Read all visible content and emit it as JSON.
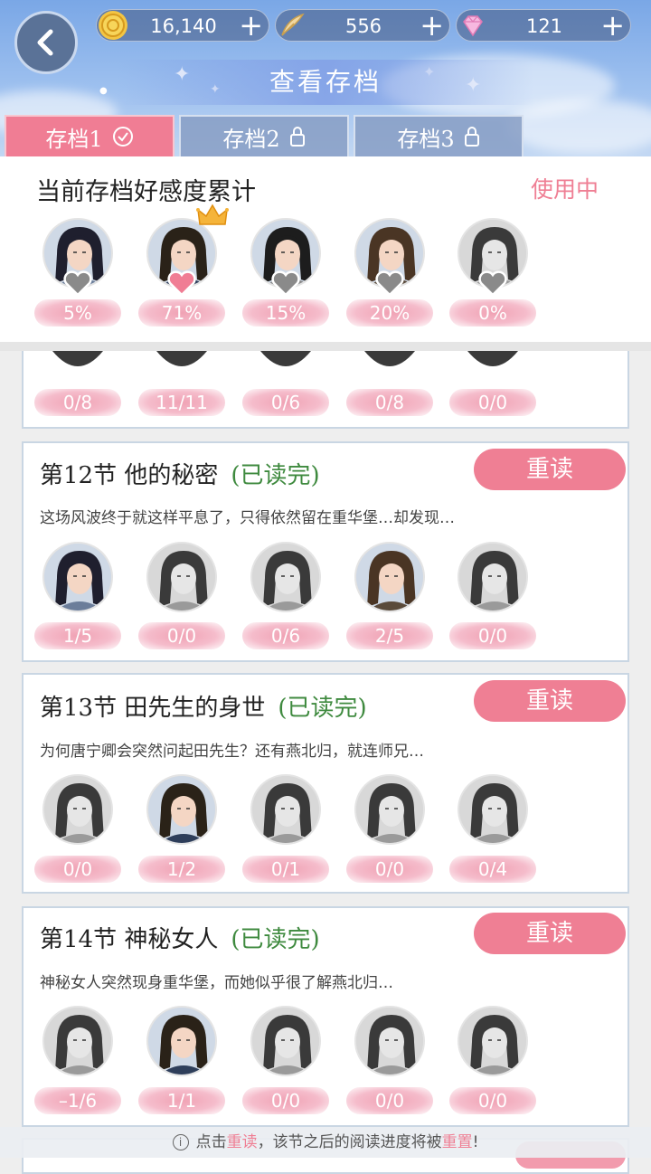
{
  "colors": {
    "accent": "#ef7f94",
    "done_green": "#3f8a3f",
    "header_blue": "#8fb3ea"
  },
  "header": {
    "back_icon": "chevron-left-icon",
    "title": "查看存档",
    "resources": [
      {
        "name": "coin",
        "icon": "coin-icon",
        "value": "16,140"
      },
      {
        "name": "quill",
        "icon": "quill-icon",
        "value": "556"
      },
      {
        "name": "diamond",
        "icon": "diamond-icon",
        "value": "121"
      }
    ],
    "tabs": [
      {
        "label": "存档1",
        "icon": "check-circle-icon",
        "active": true
      },
      {
        "label": "存档2",
        "icon": "lock-icon",
        "active": false
      },
      {
        "label": "存档3",
        "icon": "lock-icon",
        "active": false
      }
    ]
  },
  "summary": {
    "title": "当前存档好感度累计",
    "status": "使用中",
    "characters": [
      {
        "affection": "5%",
        "heart_filled": false,
        "crown": false,
        "color": true
      },
      {
        "affection": "71%",
        "heart_filled": true,
        "crown": true,
        "color": true
      },
      {
        "affection": "15%",
        "heart_filled": false,
        "crown": false,
        "color": true
      },
      {
        "affection": "20%",
        "heart_filled": false,
        "crown": false,
        "color": true
      },
      {
        "affection": "0%",
        "heart_filled": false,
        "crown": false,
        "color": false
      }
    ]
  },
  "partial_chapter": {
    "values": [
      "0/8",
      "11/11",
      "0/6",
      "0/8",
      "0/0"
    ]
  },
  "chapters": [
    {
      "title": "第12节 他的秘密",
      "status": "(已读完)",
      "description": "这场风波终于就这样平息了，只得依然留在重华堡…却发现…",
      "reread_label": "重读",
      "values": [
        "1/5",
        "0/0",
        "0/6",
        "2/5",
        "0/0"
      ],
      "color_avatars": [
        true,
        false,
        false,
        true,
        false
      ]
    },
    {
      "title": "第13节 田先生的身世",
      "status": "(已读完)",
      "description": "为何唐宁卿会突然问起田先生？还有燕北归，就连师兄…",
      "reread_label": "重读",
      "values": [
        "0/0",
        "1/2",
        "0/1",
        "0/0",
        "0/4"
      ],
      "color_avatars": [
        false,
        true,
        false,
        false,
        false
      ]
    },
    {
      "title": "第14节 神秘女人",
      "status": "(已读完)",
      "description": "神秘女人突然现身重华堡，而她似乎很了解燕北归…",
      "reread_label": "重读",
      "values": [
        "–1/6",
        "1/1",
        "0/0",
        "0/0",
        "0/0"
      ],
      "color_avatars": [
        false,
        true,
        false,
        false,
        false
      ]
    }
  ],
  "footer": {
    "info_icon": "info-icon",
    "text_1": "点击",
    "highlight_1": "重读",
    "text_2": "，该节之后的阅读进度将被",
    "highlight_2": "重置",
    "text_3": "!"
  }
}
